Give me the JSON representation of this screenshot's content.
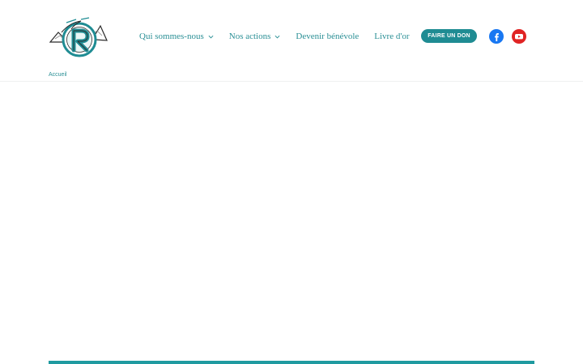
{
  "brand": {
    "logo_icon": "ski-mountain-logo-icon",
    "accent_color": "#1f8c93",
    "link_color": "#2a8f95"
  },
  "nav": {
    "items": [
      {
        "label": "Qui sommes-nous",
        "has_dropdown": true
      },
      {
        "label": "Nos actions",
        "has_dropdown": true
      },
      {
        "label": "Devenir bénévole",
        "has_dropdown": false
      },
      {
        "label": "Livre d'or",
        "has_dropdown": false
      }
    ],
    "donate_label": "FAIRE UN DON"
  },
  "social": {
    "facebook": {
      "icon": "facebook-icon",
      "color": "#1877f2"
    },
    "youtube": {
      "icon": "youtube-icon",
      "color": "#e02424"
    }
  },
  "breadcrumb": {
    "home_label": "Accueil"
  }
}
